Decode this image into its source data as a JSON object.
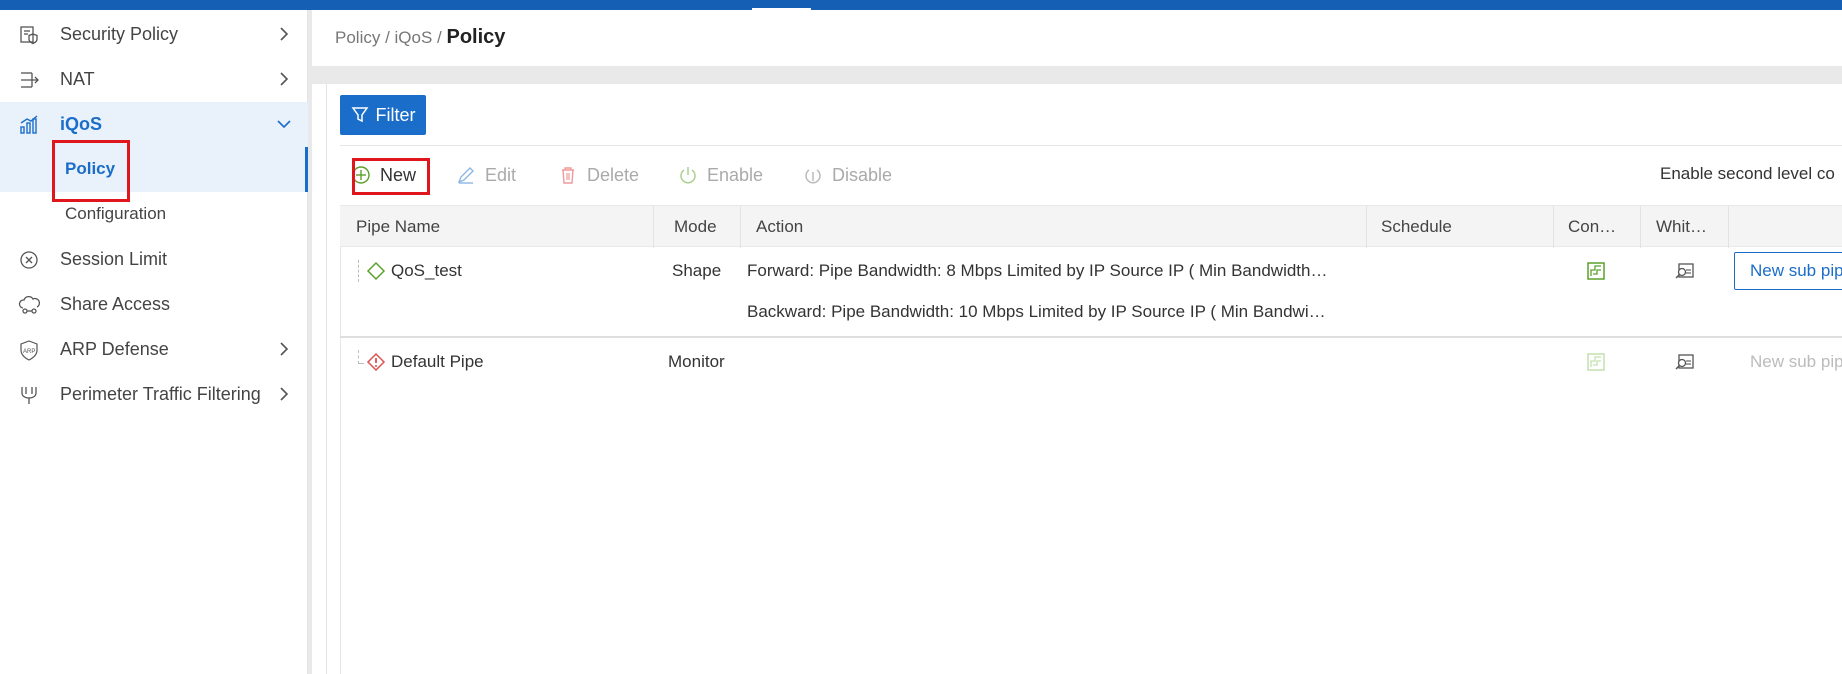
{
  "sidebar": {
    "items": [
      {
        "label": "Security Policy",
        "icon": "security-policy-icon"
      },
      {
        "label": "NAT",
        "icon": "nat-icon"
      },
      {
        "label": "iQoS",
        "icon": "iqos-icon"
      },
      {
        "label": "Session Limit",
        "icon": "session-limit-icon"
      },
      {
        "label": "Share Access",
        "icon": "share-access-icon"
      },
      {
        "label": "ARP Defense",
        "icon": "arp-defense-icon"
      },
      {
        "label": "Perimeter Traffic Filtering",
        "icon": "perimeter-filter-icon"
      }
    ],
    "sub_items": [
      {
        "label": "Policy"
      },
      {
        "label": "Configuration"
      }
    ]
  },
  "breadcrumb": {
    "part1": "Policy",
    "sep": " / ",
    "part2": "iQoS",
    "current": "Policy"
  },
  "filter_label": "Filter",
  "toolbar": {
    "new": "New",
    "edit": "Edit",
    "delete": "Delete",
    "enable": "Enable",
    "disable": "Disable",
    "second_level": "Enable second level co"
  },
  "table": {
    "headers": {
      "pipe_name": "Pipe Name",
      "mode": "Mode",
      "action": "Action",
      "schedule": "Schedule",
      "con": "Con…",
      "whit": "Whit…"
    },
    "rows": [
      {
        "name": "QoS_test",
        "mode": "Shape",
        "forward": "Forward: Pipe Bandwidth: 8 Mbps Limited by IP Source IP ( Min Bandwidth…",
        "backward": "Backward: Pipe Bandwidth: 10 Mbps Limited by IP Source IP ( Min Bandwi…",
        "button": "New sub pipe"
      },
      {
        "name": "Default Pipe",
        "mode": "Monitor",
        "button": "New sub pipe"
      }
    ]
  },
  "colors": {
    "brand": "#1a6dc9",
    "highlight": "#e0161d",
    "status_green": "#5aa02c"
  }
}
